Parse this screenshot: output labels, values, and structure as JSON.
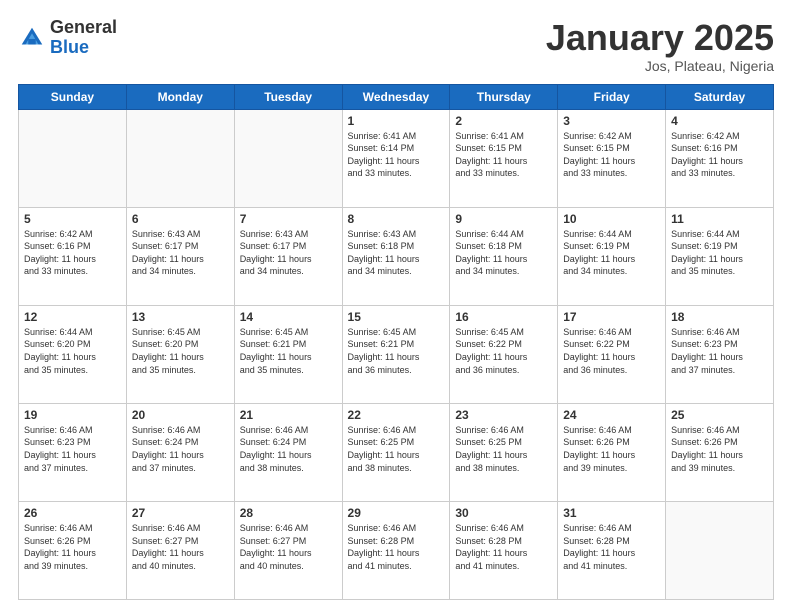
{
  "header": {
    "logo_general": "General",
    "logo_blue": "Blue",
    "title": "January 2025",
    "location": "Jos, Plateau, Nigeria"
  },
  "calendar": {
    "days_of_week": [
      "Sunday",
      "Monday",
      "Tuesday",
      "Wednesday",
      "Thursday",
      "Friday",
      "Saturday"
    ],
    "weeks": [
      [
        {
          "day": "",
          "info": ""
        },
        {
          "day": "",
          "info": ""
        },
        {
          "day": "",
          "info": ""
        },
        {
          "day": "1",
          "info": "Sunrise: 6:41 AM\nSunset: 6:14 PM\nDaylight: 11 hours\nand 33 minutes."
        },
        {
          "day": "2",
          "info": "Sunrise: 6:41 AM\nSunset: 6:15 PM\nDaylight: 11 hours\nand 33 minutes."
        },
        {
          "day": "3",
          "info": "Sunrise: 6:42 AM\nSunset: 6:15 PM\nDaylight: 11 hours\nand 33 minutes."
        },
        {
          "day": "4",
          "info": "Sunrise: 6:42 AM\nSunset: 6:16 PM\nDaylight: 11 hours\nand 33 minutes."
        }
      ],
      [
        {
          "day": "5",
          "info": "Sunrise: 6:42 AM\nSunset: 6:16 PM\nDaylight: 11 hours\nand 33 minutes."
        },
        {
          "day": "6",
          "info": "Sunrise: 6:43 AM\nSunset: 6:17 PM\nDaylight: 11 hours\nand 34 minutes."
        },
        {
          "day": "7",
          "info": "Sunrise: 6:43 AM\nSunset: 6:17 PM\nDaylight: 11 hours\nand 34 minutes."
        },
        {
          "day": "8",
          "info": "Sunrise: 6:43 AM\nSunset: 6:18 PM\nDaylight: 11 hours\nand 34 minutes."
        },
        {
          "day": "9",
          "info": "Sunrise: 6:44 AM\nSunset: 6:18 PM\nDaylight: 11 hours\nand 34 minutes."
        },
        {
          "day": "10",
          "info": "Sunrise: 6:44 AM\nSunset: 6:19 PM\nDaylight: 11 hours\nand 34 minutes."
        },
        {
          "day": "11",
          "info": "Sunrise: 6:44 AM\nSunset: 6:19 PM\nDaylight: 11 hours\nand 35 minutes."
        }
      ],
      [
        {
          "day": "12",
          "info": "Sunrise: 6:44 AM\nSunset: 6:20 PM\nDaylight: 11 hours\nand 35 minutes."
        },
        {
          "day": "13",
          "info": "Sunrise: 6:45 AM\nSunset: 6:20 PM\nDaylight: 11 hours\nand 35 minutes."
        },
        {
          "day": "14",
          "info": "Sunrise: 6:45 AM\nSunset: 6:21 PM\nDaylight: 11 hours\nand 35 minutes."
        },
        {
          "day": "15",
          "info": "Sunrise: 6:45 AM\nSunset: 6:21 PM\nDaylight: 11 hours\nand 36 minutes."
        },
        {
          "day": "16",
          "info": "Sunrise: 6:45 AM\nSunset: 6:22 PM\nDaylight: 11 hours\nand 36 minutes."
        },
        {
          "day": "17",
          "info": "Sunrise: 6:46 AM\nSunset: 6:22 PM\nDaylight: 11 hours\nand 36 minutes."
        },
        {
          "day": "18",
          "info": "Sunrise: 6:46 AM\nSunset: 6:23 PM\nDaylight: 11 hours\nand 37 minutes."
        }
      ],
      [
        {
          "day": "19",
          "info": "Sunrise: 6:46 AM\nSunset: 6:23 PM\nDaylight: 11 hours\nand 37 minutes."
        },
        {
          "day": "20",
          "info": "Sunrise: 6:46 AM\nSunset: 6:24 PM\nDaylight: 11 hours\nand 37 minutes."
        },
        {
          "day": "21",
          "info": "Sunrise: 6:46 AM\nSunset: 6:24 PM\nDaylight: 11 hours\nand 38 minutes."
        },
        {
          "day": "22",
          "info": "Sunrise: 6:46 AM\nSunset: 6:25 PM\nDaylight: 11 hours\nand 38 minutes."
        },
        {
          "day": "23",
          "info": "Sunrise: 6:46 AM\nSunset: 6:25 PM\nDaylight: 11 hours\nand 38 minutes."
        },
        {
          "day": "24",
          "info": "Sunrise: 6:46 AM\nSunset: 6:26 PM\nDaylight: 11 hours\nand 39 minutes."
        },
        {
          "day": "25",
          "info": "Sunrise: 6:46 AM\nSunset: 6:26 PM\nDaylight: 11 hours\nand 39 minutes."
        }
      ],
      [
        {
          "day": "26",
          "info": "Sunrise: 6:46 AM\nSunset: 6:26 PM\nDaylight: 11 hours\nand 39 minutes."
        },
        {
          "day": "27",
          "info": "Sunrise: 6:46 AM\nSunset: 6:27 PM\nDaylight: 11 hours\nand 40 minutes."
        },
        {
          "day": "28",
          "info": "Sunrise: 6:46 AM\nSunset: 6:27 PM\nDaylight: 11 hours\nand 40 minutes."
        },
        {
          "day": "29",
          "info": "Sunrise: 6:46 AM\nSunset: 6:28 PM\nDaylight: 11 hours\nand 41 minutes."
        },
        {
          "day": "30",
          "info": "Sunrise: 6:46 AM\nSunset: 6:28 PM\nDaylight: 11 hours\nand 41 minutes."
        },
        {
          "day": "31",
          "info": "Sunrise: 6:46 AM\nSunset: 6:28 PM\nDaylight: 11 hours\nand 41 minutes."
        },
        {
          "day": "",
          "info": ""
        }
      ]
    ]
  }
}
